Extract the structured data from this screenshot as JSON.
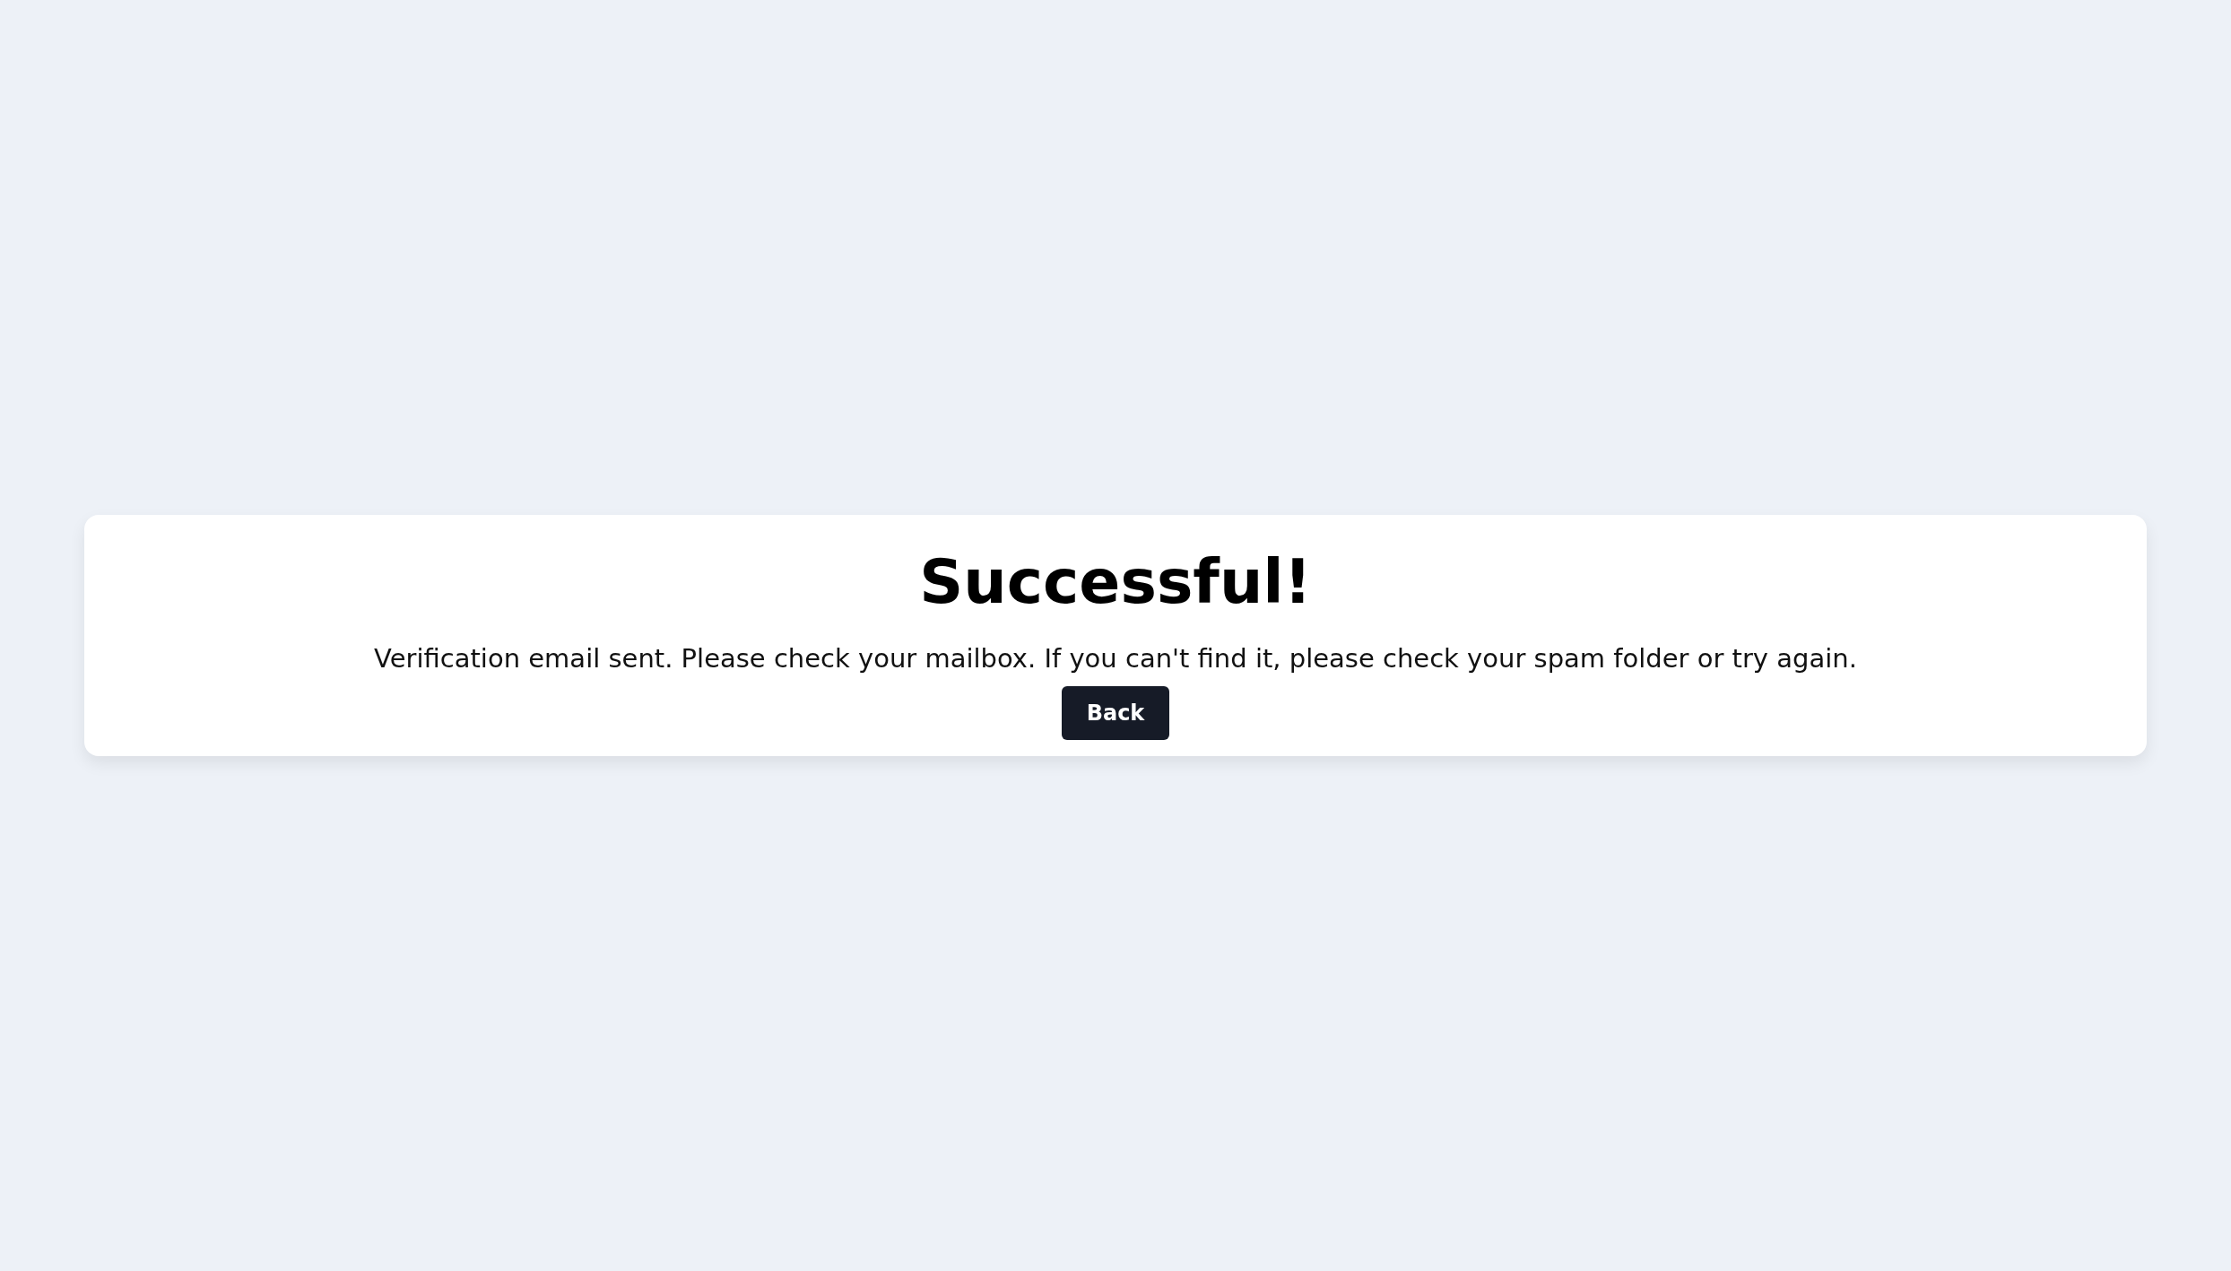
{
  "card": {
    "title": "Successful!",
    "message": "Verification email sent. Please check your mailbox. If you can't find it, please check your spam folder or try again.",
    "button": "Back"
  }
}
